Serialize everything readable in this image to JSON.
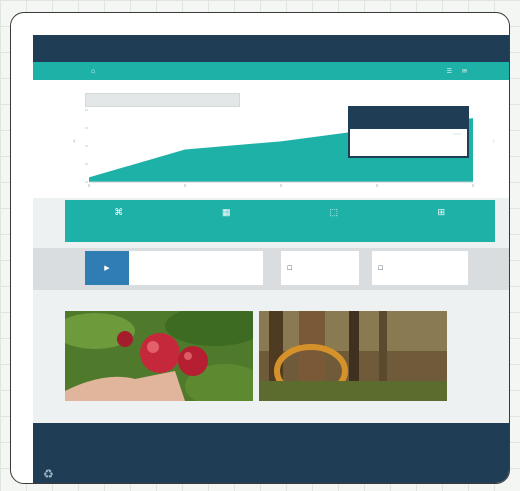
{
  "header": {
    "brand": "",
    "top_link": "",
    "menu": ""
  },
  "subnav": {
    "home_glyph": "⌂",
    "home_label": "",
    "icons": [
      "☰",
      "✉"
    ]
  },
  "chart": {
    "title_box_text": "",
    "top_link": "",
    "arrow_left": "‹",
    "arrow_right": "›",
    "fill_color": "#1eb1a8",
    "card": {
      "label": "",
      "value": "",
      "row_left": "",
      "row_right": ""
    }
  },
  "chart_data": {
    "type": "area",
    "x": [
      0,
      1,
      2,
      3,
      4
    ],
    "values": [
      4,
      28,
      35,
      46,
      55
    ],
    "ylim": [
      0,
      62
    ],
    "title": "",
    "xlabel": "",
    "ylabel": "",
    "grid": false,
    "legend": "none"
  },
  "stats": [
    {
      "icon": "⌘",
      "label": ""
    },
    {
      "icon": "▦",
      "label": ""
    },
    {
      "icon": "⬚",
      "label": ""
    },
    {
      "icon": "⊞",
      "label": ""
    }
  ],
  "promo": {
    "image_icon": "▶",
    "line1": "",
    "line2": "",
    "mid_icon": "☐",
    "mid_cta": "",
    "right_icon": "☐",
    "right_cta": ""
  },
  "photos": {
    "caption": ""
  },
  "footer": {
    "brand": "",
    "link": "",
    "col": "",
    "note": "",
    "badge": "♻"
  },
  "colors": {
    "navy": "#1f3e55",
    "teal": "#1eb1a8",
    "grid": "#dfe6e0"
  }
}
